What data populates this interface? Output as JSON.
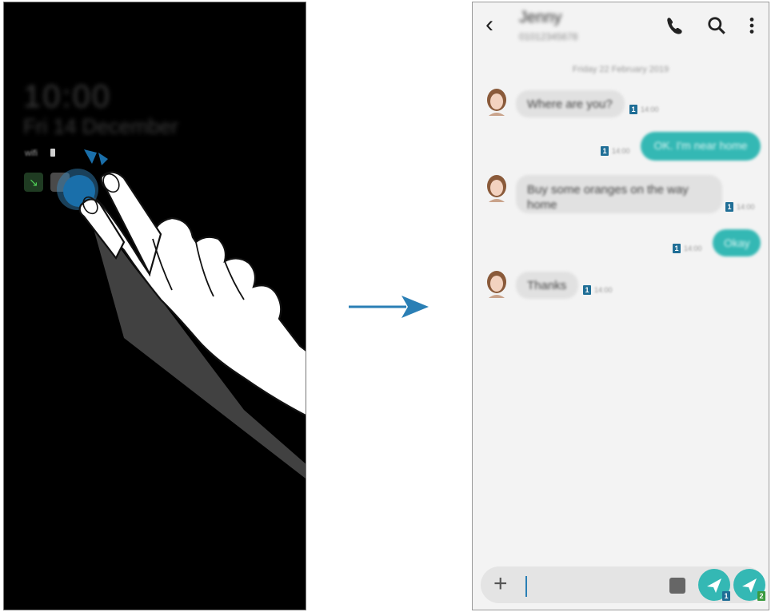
{
  "aod": {
    "time": "10:00",
    "date": "Fri 14 December",
    "status_text": "wifi"
  },
  "messaging": {
    "contact_name": "Jenny",
    "contact_number": "01012345678",
    "date_separator": "Friday 22 February 2019",
    "messages": [
      {
        "direction": "in",
        "text": "Where are you?",
        "time": "14:00",
        "sim": "1"
      },
      {
        "direction": "out",
        "text": "OK. I'm near home",
        "time": "14:00",
        "sim": "1"
      },
      {
        "direction": "in",
        "text": "Buy some oranges on the way home",
        "time": "14:00",
        "sim": "1"
      },
      {
        "direction": "out",
        "text": "Okay",
        "time": "14:00",
        "sim": "1"
      },
      {
        "direction": "in",
        "text": "Thanks",
        "time": "14:00",
        "sim": "1"
      }
    ],
    "composer": {
      "placeholder": "",
      "send_sim_1": "1",
      "send_sim_2": "2"
    }
  },
  "colors": {
    "accent": "#34b8b4",
    "sim_badge": "#1f6e96",
    "arrow": "#2a7fb5"
  }
}
